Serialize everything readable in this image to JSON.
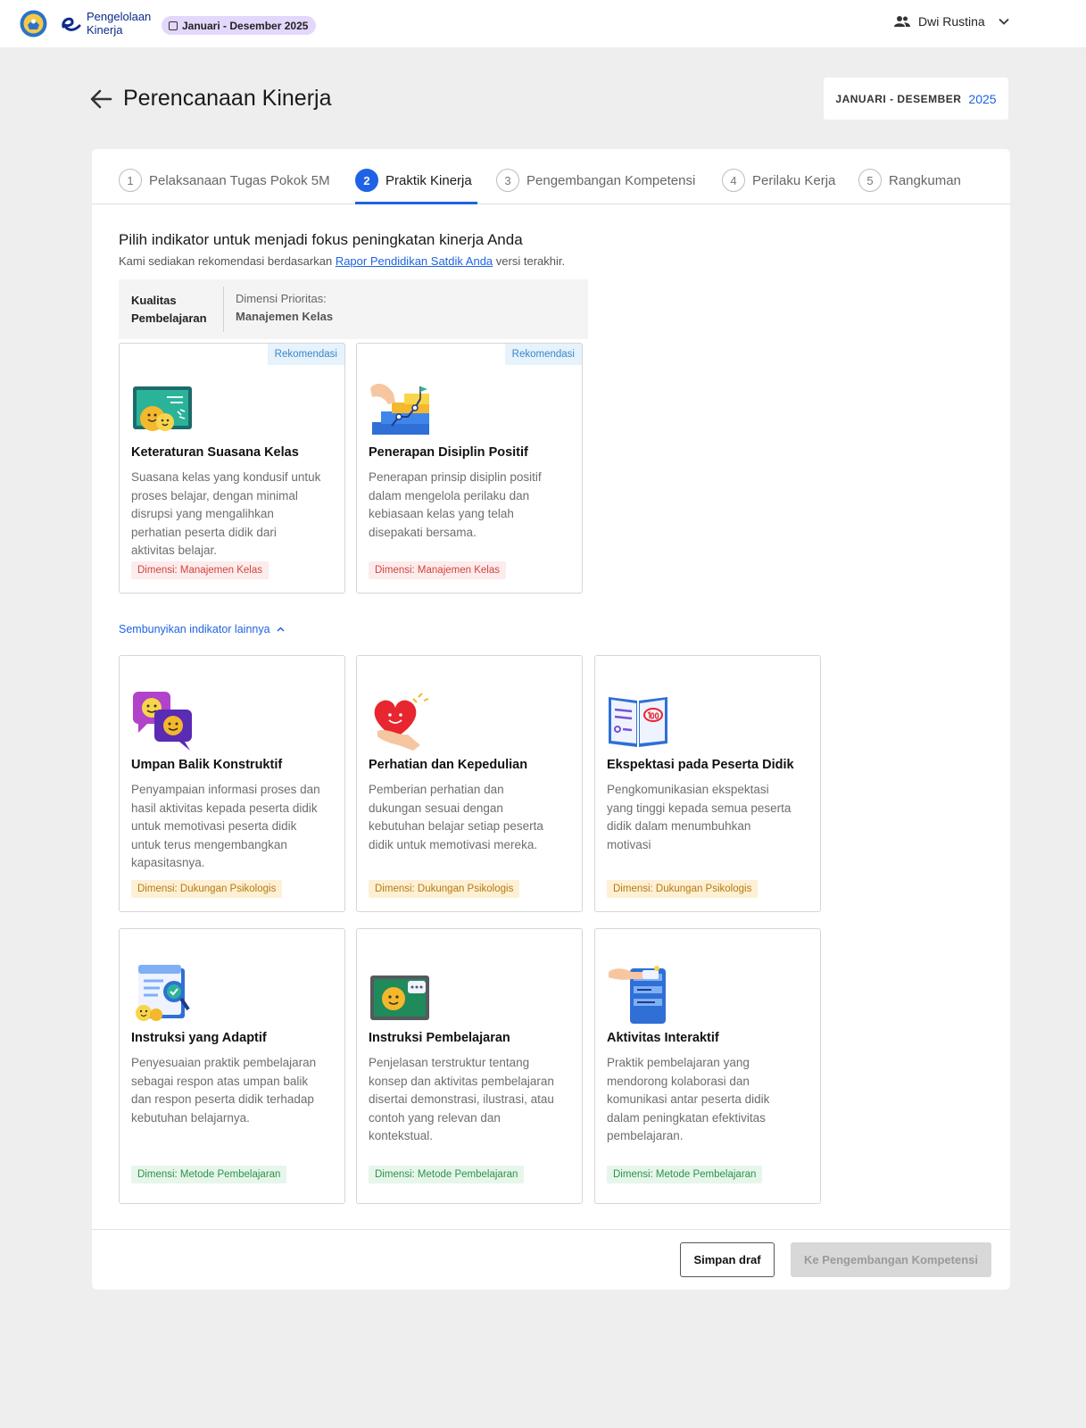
{
  "header": {
    "brand_line1": "Pengelolaan",
    "brand_line2": "Kinerja",
    "period_pill": "Januari - Desember 2025",
    "user_name": "Dwi Rustina"
  },
  "page": {
    "title": "Perencanaan Kinerja",
    "period_label": "JANUARI - DESEMBER",
    "period_year": "2025"
  },
  "tabs": [
    {
      "num": "1",
      "label": "Pelaksanaan Tugas Pokok 5M",
      "active": false
    },
    {
      "num": "2",
      "label": "Praktik Kinerja",
      "active": true
    },
    {
      "num": "3",
      "label": "Pengembangan Kompetensi",
      "active": false
    },
    {
      "num": "4",
      "label": "Perilaku Kerja",
      "active": false
    },
    {
      "num": "5",
      "label": "Rangkuman",
      "active": false
    }
  ],
  "section": {
    "title": "Pilih indikator untuk menjadi fokus peningkatan kinerja Anda",
    "subtitle_before": "Kami sediakan rekomendasi berdasarkan",
    "subtitle_link": "Rapor Pendidikan Satdik Anda",
    "subtitle_after": "versi terakhir."
  },
  "dimension_box": {
    "category_line1": "Kualitas",
    "category_line2": "Pembelajaran",
    "priority_label": "Dimensi Prioritas:",
    "priority_value": "Manajemen Kelas"
  },
  "recommended": [
    {
      "badge": "Rekomendasi",
      "icon": "classroom-board-icon",
      "title": "Keteraturan Suasana Kelas",
      "desc": "Suasana kelas yang kondusif untuk proses belajar, dengan minimal disrupsi yang mengalihkan perhatian peserta didik dari aktivitas belajar.",
      "tag": "Dimensi: Manajemen Kelas"
    },
    {
      "badge": "Rekomendasi",
      "icon": "stairs-goal-icon",
      "title": "Penerapan Disiplin Positif",
      "desc": "Penerapan prinsip disiplin positif dalam mengelola perilaku dan kebiasaan kelas yang telah disepakati bersama.",
      "tag": "Dimensi: Manajemen Kelas"
    }
  ],
  "toggle_label": "Sembunyikan indikator lainnya",
  "others": [
    {
      "icon": "chat-smiley-icon",
      "title": "Umpan Balik Konstruktif",
      "desc": "Penyampaian informasi proses dan hasil aktivitas kepada peserta didik untuk memotivasi peserta didik untuk terus mengembangkan kapasitasnya.",
      "tag": "Dimensi: Dukungan Psikologis"
    },
    {
      "icon": "heart-hand-icon",
      "title": "Perhatian dan Kepedulian",
      "desc": "Pemberian perhatian dan dukungan sesuai dengan kebutuhan belajar setiap peserta didik untuk memotivasi mereka.",
      "tag": "Dimensi: Dukungan Psikologis"
    },
    {
      "icon": "open-book-score-icon",
      "title": "Ekspektasi pada Peserta Didik",
      "desc": "Pengkomunikasian ekspektasi yang tinggi kepada semua peserta didik dalam menumbuhkan motivasi",
      "tag": "Dimensi: Dukungan Psikologis"
    },
    {
      "icon": "document-check-icon",
      "title": "Instruksi yang Adaptif",
      "desc": "Penyesuaian praktik pembelajaran sebagai respon atas umpan balik dan respon peserta didik terhadap kebutuhan belajarnya.",
      "tag": "Dimensi: Metode Pembelajaran"
    },
    {
      "icon": "chalkboard-speech-icon",
      "title": "Instruksi Pembelajaran",
      "desc": "Penjelasan terstruktur tentang konsep dan aktivitas pembelajaran disertai demonstrasi, ilustrasi, atau contoh yang relevan dan kontekstual.",
      "tag": "Dimensi: Metode Pembelajaran"
    },
    {
      "icon": "phone-interaction-icon",
      "title": "Aktivitas Interaktif",
      "desc": "Praktik pembelajaran yang mendorong kolaborasi dan komunikasi antar peserta didik dalam peningkatan efektivitas pembelajaran.",
      "tag": "Dimensi: Metode Pembelajaran"
    }
  ],
  "footer": {
    "draft_label": "Simpan draf",
    "next_label": "Ke Pengembangan Kompetensi"
  },
  "colors": {
    "primary": "#1e63e6",
    "period_pill_bg": "#e3d7fb",
    "tag_red": "#d2433f",
    "tag_orange": "#b67a10",
    "tag_green": "#2e9249"
  }
}
